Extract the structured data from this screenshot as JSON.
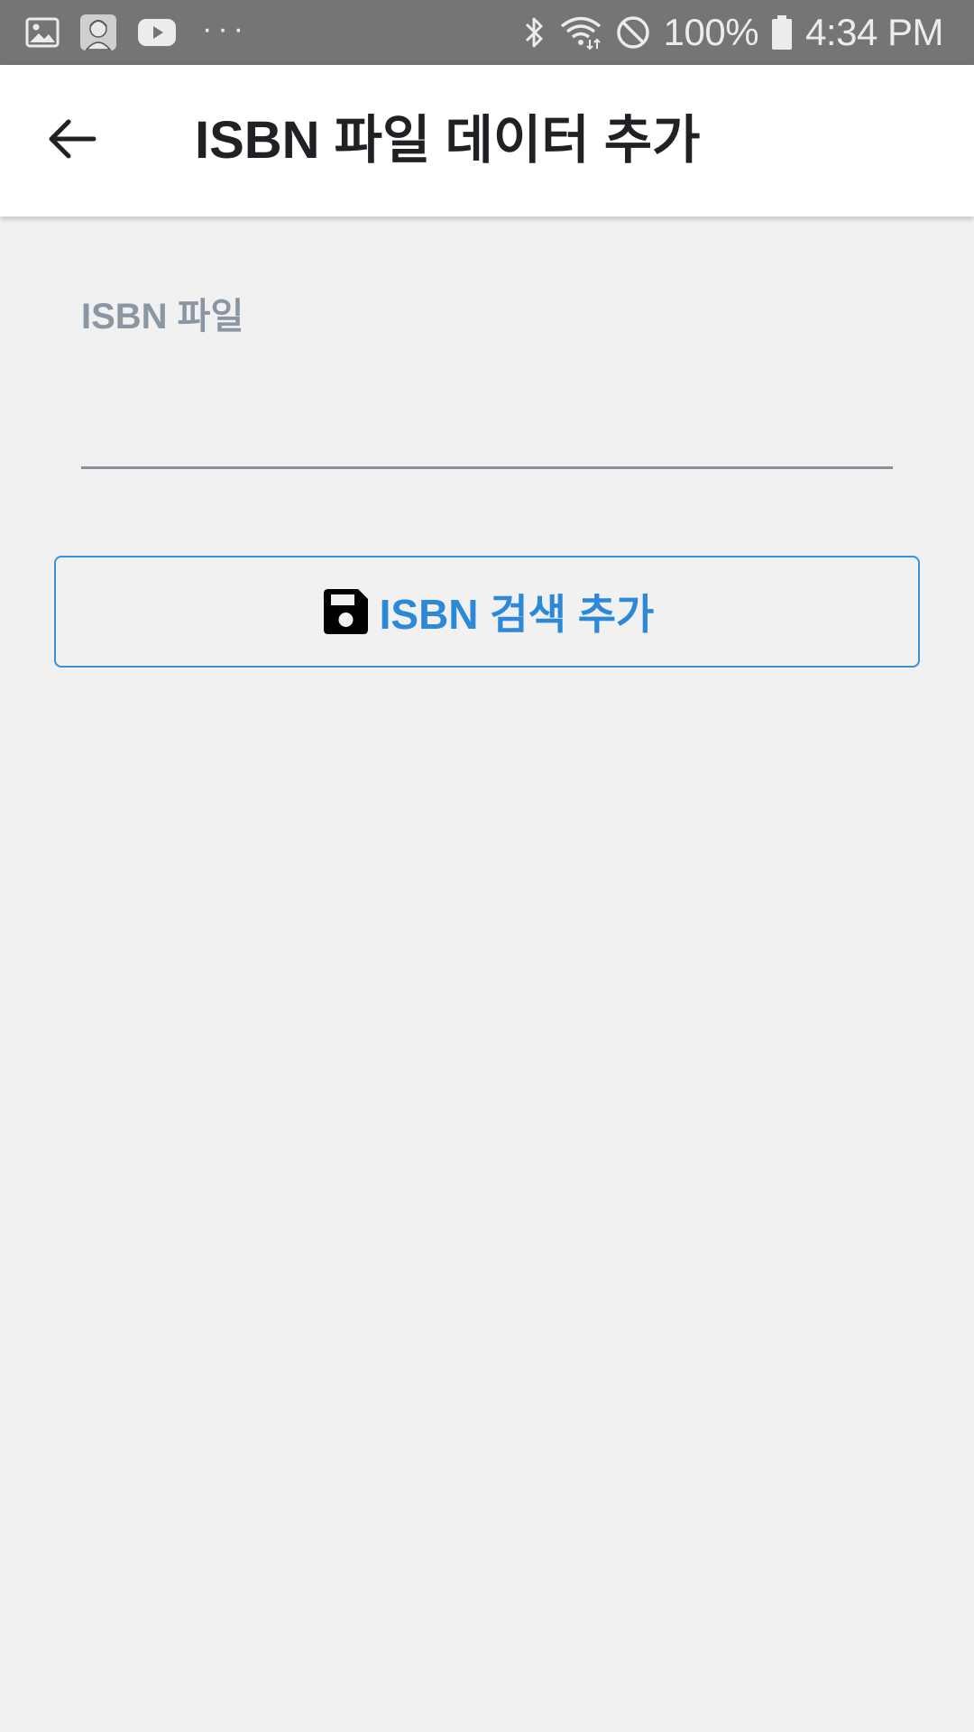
{
  "status_bar": {
    "battery": "100%",
    "time": "4:34 PM",
    "overflow": "···",
    "icons": [
      "gallery-icon",
      "avatar-notification-icon",
      "youtube-icon",
      "bluetooth-icon",
      "wifi-icon",
      "do-not-disturb-icon",
      "battery-icon"
    ]
  },
  "app_bar": {
    "title": "ISBN 파일 데이터 추가",
    "back_icon": "arrow-back-icon"
  },
  "form": {
    "field_label": "ISBN 파일",
    "field_value": "",
    "button_label": "ISBN 검색 추가",
    "button_icon": "save-icon"
  },
  "colors": {
    "status_bar": "#757575",
    "background": "#f1f1f2",
    "accent": "#2d88d8",
    "label": "#8b96a3"
  }
}
